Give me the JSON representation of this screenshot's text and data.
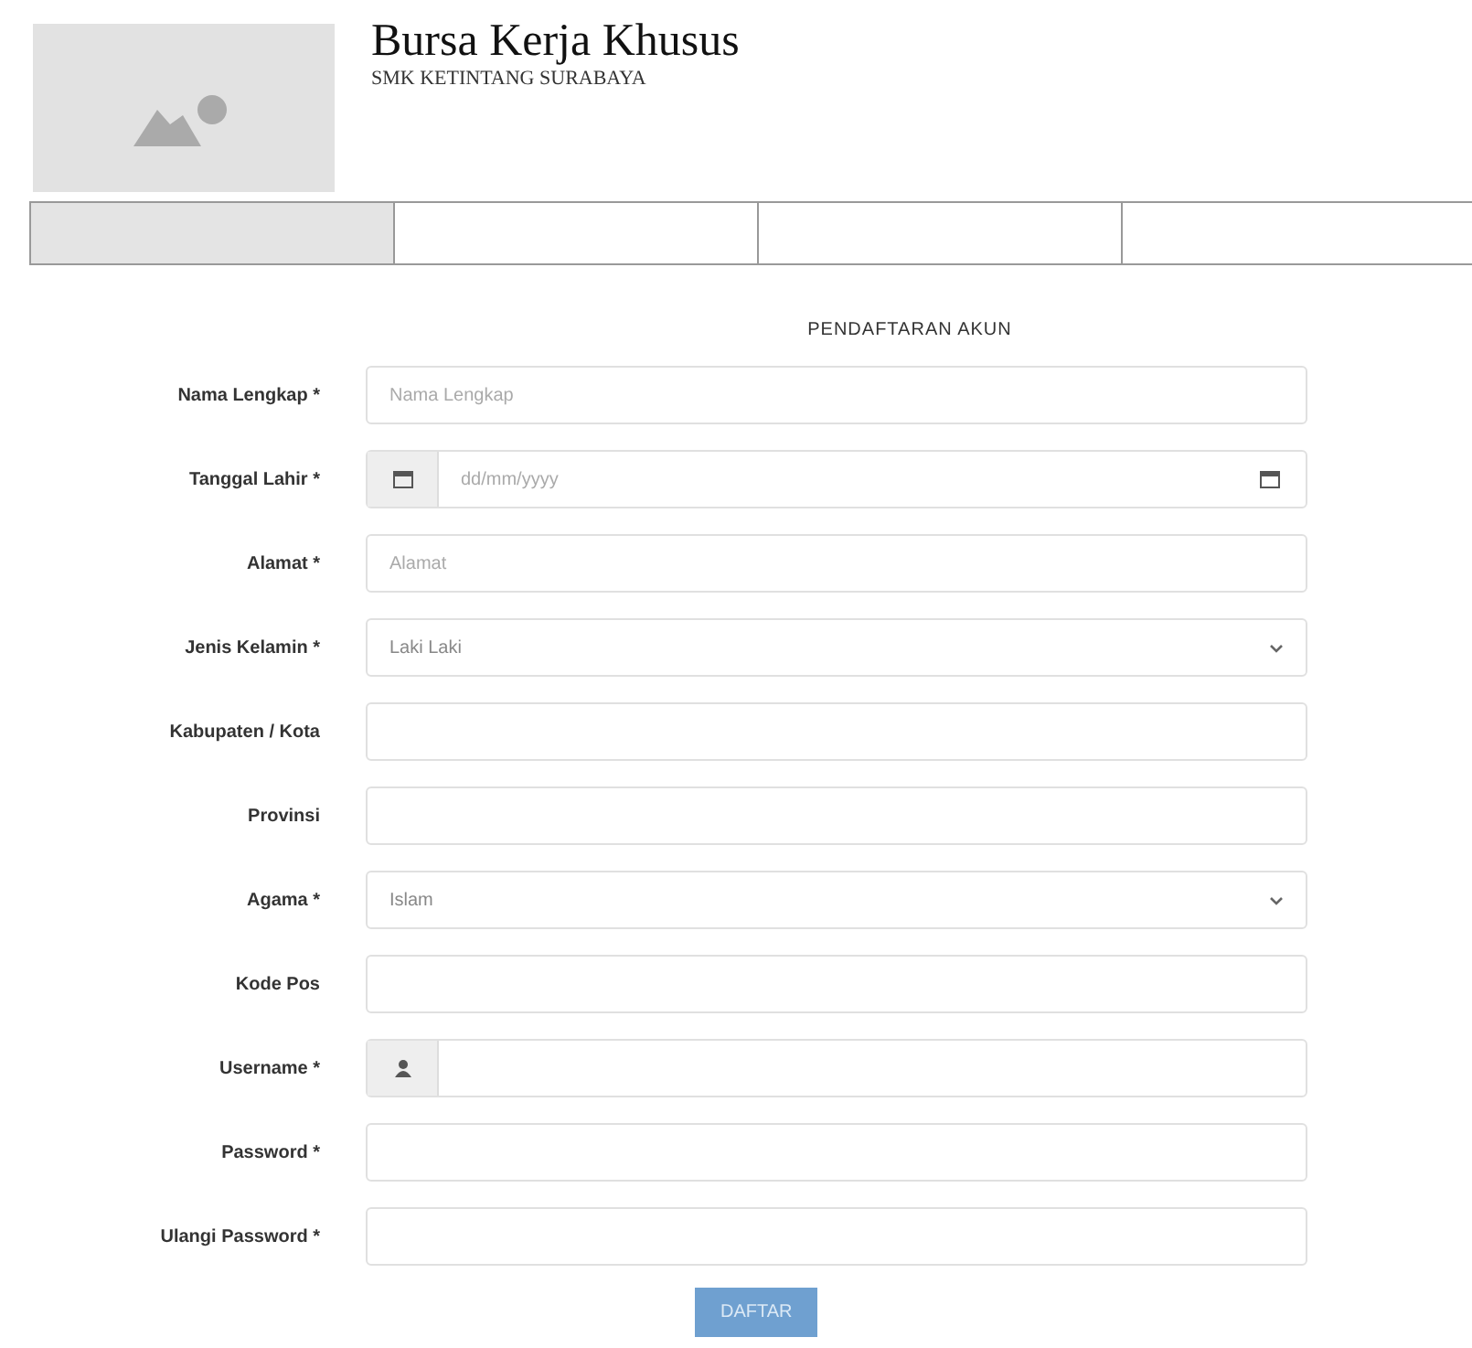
{
  "header": {
    "title": "Bursa Kerja Khusus",
    "subtitle": "SMK KETINTANG SURABAYA"
  },
  "nav": [
    {
      "selected": true
    },
    {
      "selected": false
    },
    {
      "selected": false
    },
    {
      "selected": false
    }
  ],
  "form": {
    "heading": "PENDAFTARAN AKUN",
    "fields": [
      {
        "label": "Nama Lengkap *",
        "kind": "text",
        "placeholder": "Nama Lengkap"
      },
      {
        "label": "Tanggal Lahir *",
        "kind": "date",
        "placeholder": "dd/mm/yyyy"
      },
      {
        "label": "Alamat *",
        "kind": "text",
        "placeholder": "Alamat"
      },
      {
        "label": "Jenis Kelamin *",
        "kind": "select",
        "value": "Laki Laki"
      },
      {
        "label": "Kabupaten / Kota",
        "kind": "text"
      },
      {
        "label": "Provinsi",
        "kind": "text"
      },
      {
        "label": "Agama *",
        "kind": "select",
        "value": "Islam"
      },
      {
        "label": "Kode Pos",
        "kind": "text"
      },
      {
        "label": "Username *",
        "kind": "username"
      },
      {
        "label": "Password *",
        "kind": "text"
      },
      {
        "label": "Ulangi Password *",
        "kind": "text"
      }
    ],
    "submit": "DAFTAR"
  }
}
